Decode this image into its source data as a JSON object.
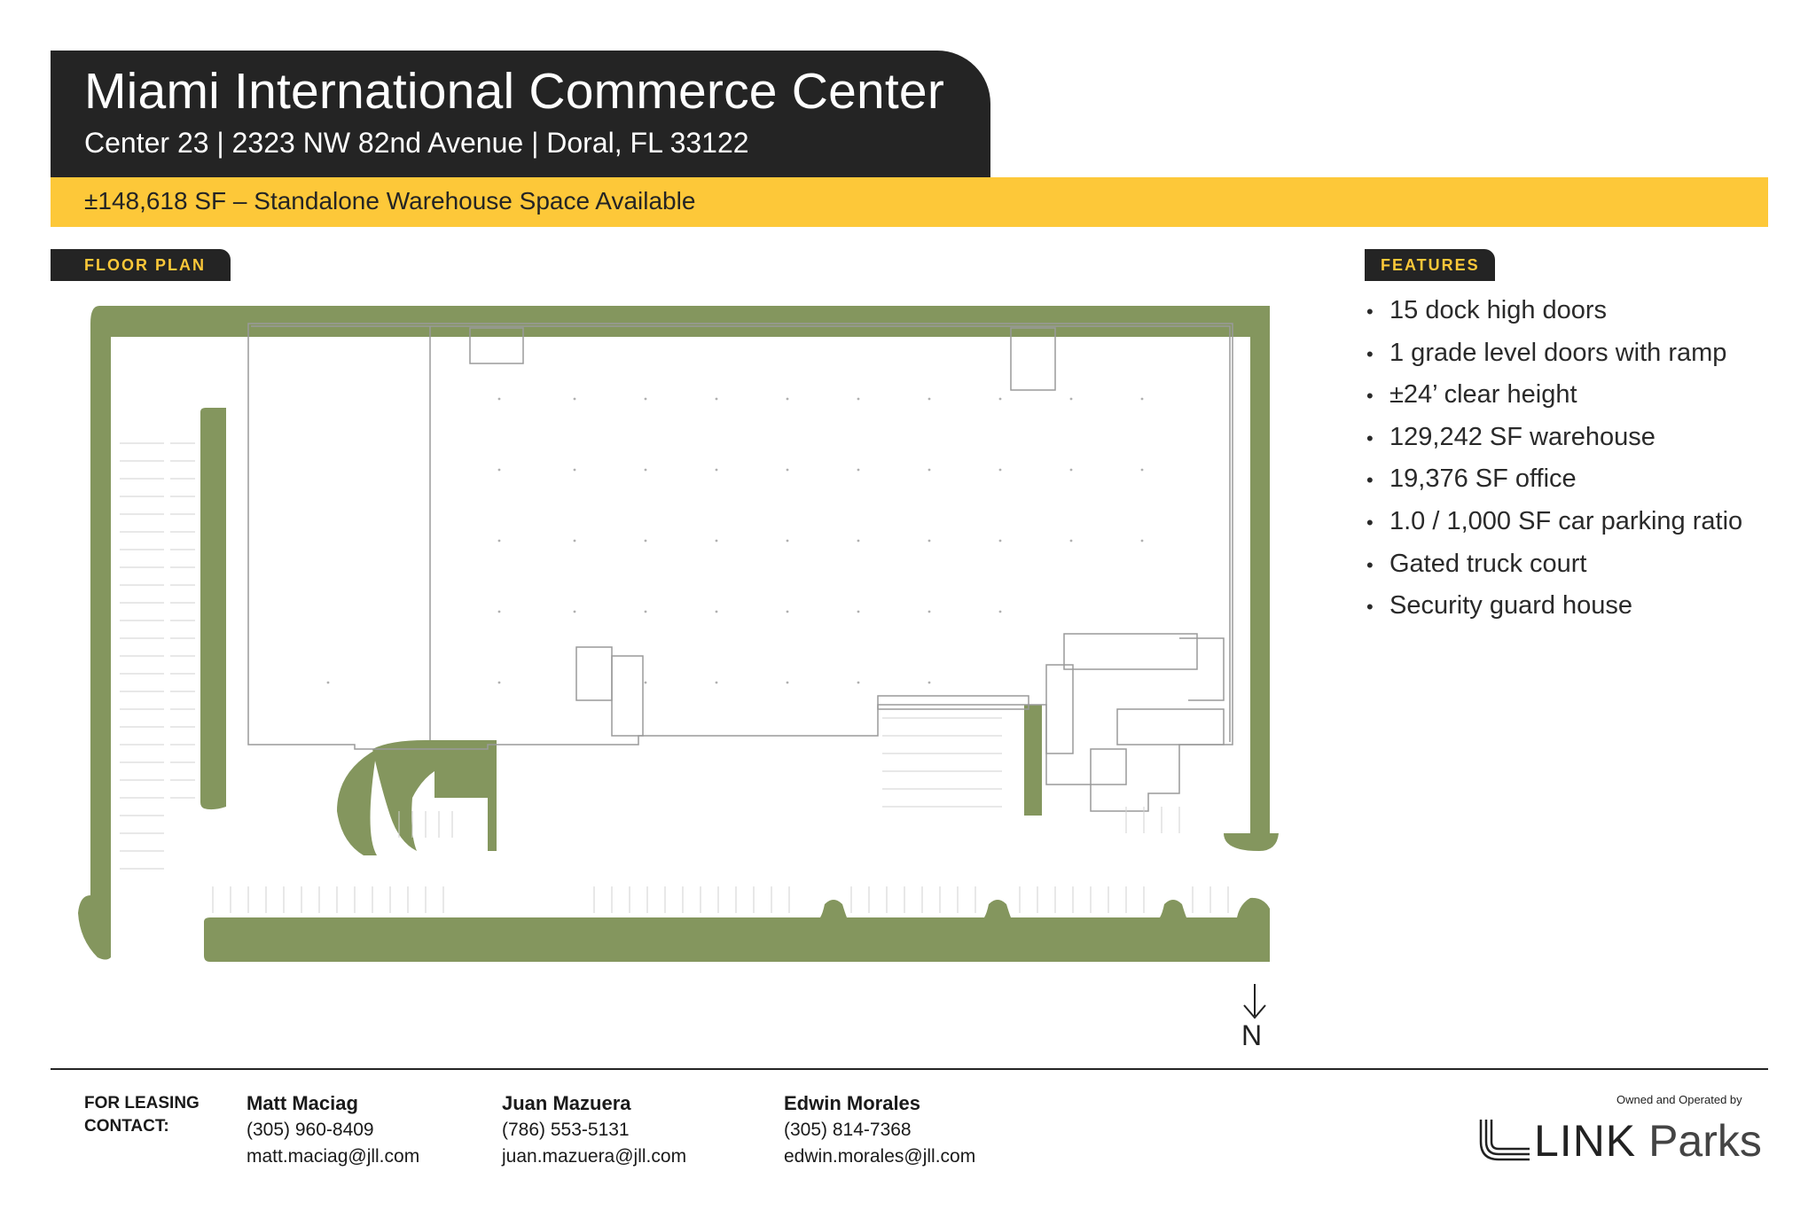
{
  "header": {
    "title": "Miami International Commerce Center",
    "subtitle": "Center 23 | 2323 NW 82nd Avenue | Doral, FL 33122"
  },
  "banner": {
    "text": "±148,618 SF  – Standalone Warehouse Space Available"
  },
  "sections": {
    "floor_plan": "FLOOR PLAN",
    "features": "FEATURES"
  },
  "features": [
    "15 dock high doors",
    "1 grade level doors with ramp",
    "±24’ clear height",
    "129,242 SF warehouse",
    "19,376 SF office",
    "1.0 / 1,000 SF car parking ratio",
    "Gated truck court",
    "Security guard house"
  ],
  "compass": {
    "label": "N"
  },
  "leasing": {
    "label": "FOR LEASING\nCONTACT:",
    "contacts": [
      {
        "name": "Matt Maciag",
        "phone": "(305) 960-8409",
        "email": "matt.maciag@jll.com"
      },
      {
        "name": "Juan Mazuera",
        "phone": "(786) 553-5131",
        "email": "juan.mazuera@jll.com"
      },
      {
        "name": "Edwin Morales",
        "phone": "(305) 814-7368",
        "email": "edwin.morales@jll.com"
      }
    ]
  },
  "owner": {
    "owned_text": "Owned and Operated by",
    "logo_bold": "LINK",
    "logo_light": "Parks"
  },
  "colors": {
    "dark": "#242424",
    "yellow": "#fdc839",
    "green": "#84965e"
  }
}
